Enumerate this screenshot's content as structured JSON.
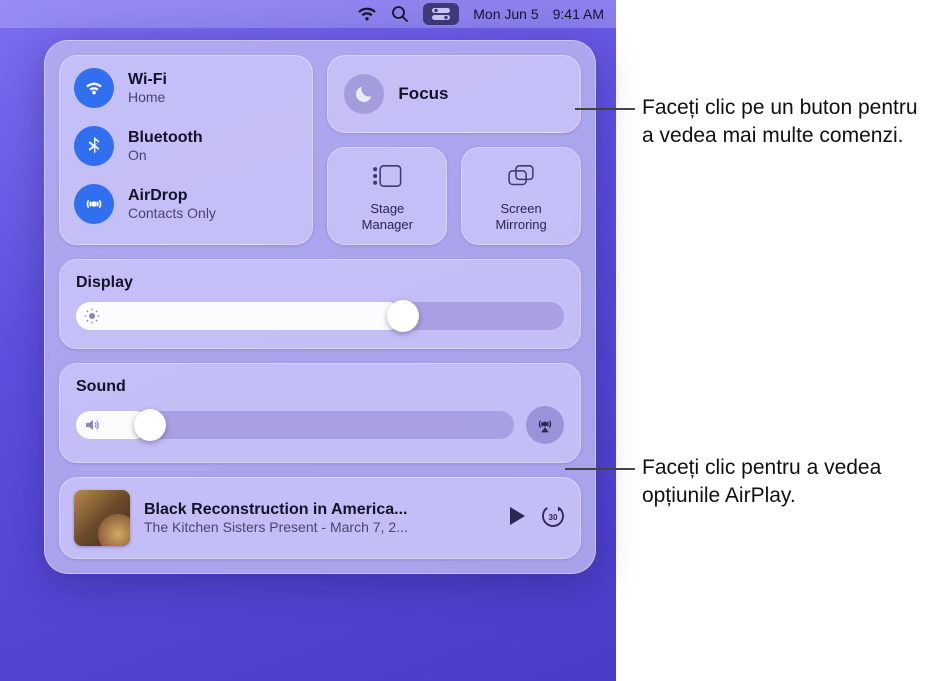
{
  "menubar": {
    "date": "Mon Jun 5",
    "time": "9:41 AM"
  },
  "connectivity": {
    "wifi": {
      "title": "Wi-Fi",
      "status": "Home"
    },
    "bluetooth": {
      "title": "Bluetooth",
      "status": "On"
    },
    "airdrop": {
      "title": "AirDrop",
      "status": "Contacts Only"
    }
  },
  "focus": {
    "title": "Focus"
  },
  "utilities": {
    "stage": {
      "label": "Stage\nManager"
    },
    "mirror": {
      "label": "Screen\nMirroring"
    }
  },
  "display": {
    "heading": "Display",
    "percent": 67
  },
  "sound": {
    "heading": "Sound",
    "percent": 17
  },
  "media": {
    "title": "Black Reconstruction in America...",
    "subtitle": "The Kitchen Sisters Present - March 7, 2..."
  },
  "callouts": {
    "focus": "Faceți clic pe un buton pentru a vedea mai multe comenzi.",
    "airplay": "Faceți clic pentru a vedea opțiunile AirPlay."
  }
}
